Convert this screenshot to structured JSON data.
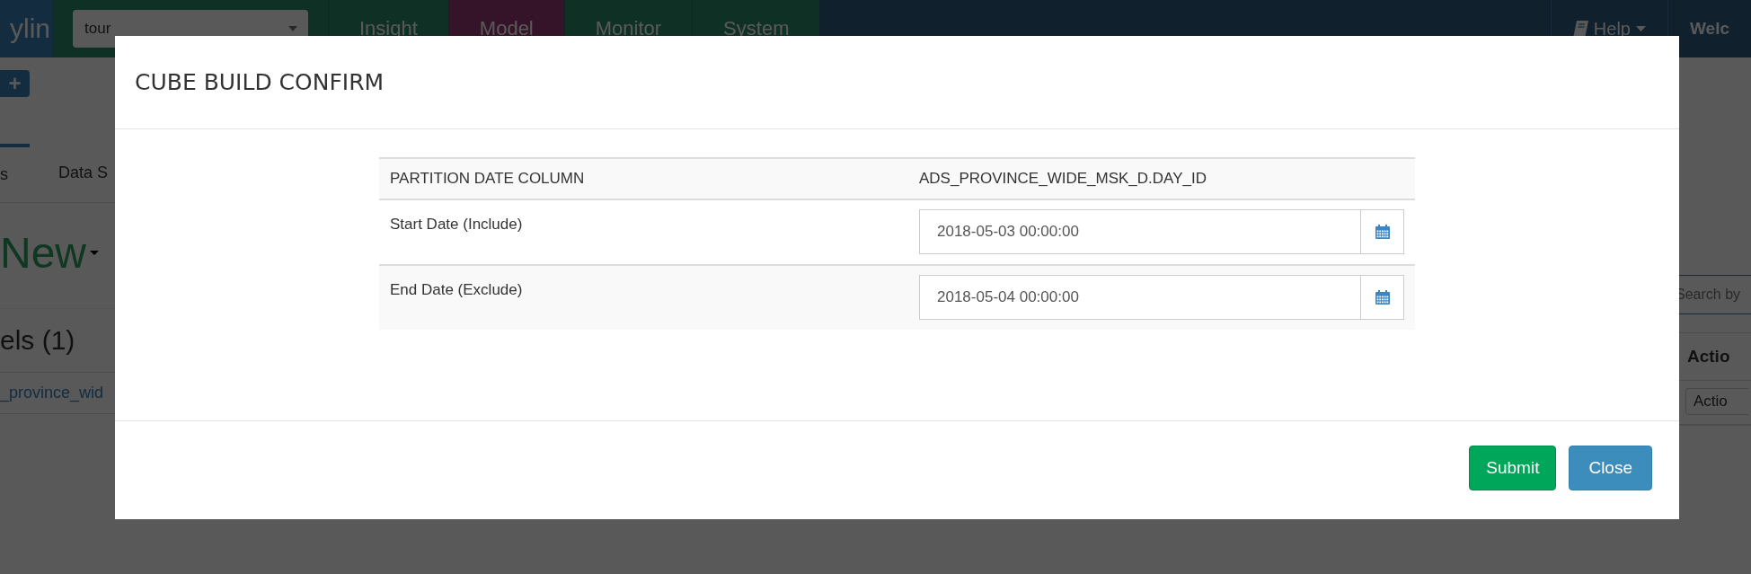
{
  "navbar": {
    "brand": "ylin",
    "project_select": {
      "value": "tour"
    },
    "tabs": [
      {
        "label": "Insight",
        "selected": false
      },
      {
        "label": "Model",
        "selected": true
      },
      {
        "label": "Monitor",
        "selected": false
      },
      {
        "label": "System",
        "selected": false
      }
    ],
    "help": "Help",
    "welcome": "Welc"
  },
  "page": {
    "add_button": "+",
    "tabs": [
      {
        "label": "s",
        "selected": true
      },
      {
        "label": "Data S",
        "selected": false
      }
    ],
    "new_menu": "New",
    "models_heading": "els (1)",
    "model_link": "_province_wid",
    "search": {
      "placeholder": "Search by"
    },
    "table_header": "Actio",
    "action_button": "Actio"
  },
  "dialog": {
    "title": "CUBE BUILD CONFIRM",
    "rows": [
      {
        "kind": "text",
        "label": "PARTITION DATE COLUMN",
        "value": "ADS_PROVINCE_WIDE_MSK_D.DAY_ID"
      },
      {
        "kind": "date",
        "label": "Start Date (Include)",
        "value": "2018-05-03 00:00:00"
      },
      {
        "kind": "date",
        "label": "End Date (Exclude)",
        "value": "2018-05-04 00:00:00"
      }
    ],
    "buttons": [
      {
        "label": "Submit",
        "kind": "success"
      },
      {
        "label": "Close",
        "kind": "info"
      }
    ]
  }
}
